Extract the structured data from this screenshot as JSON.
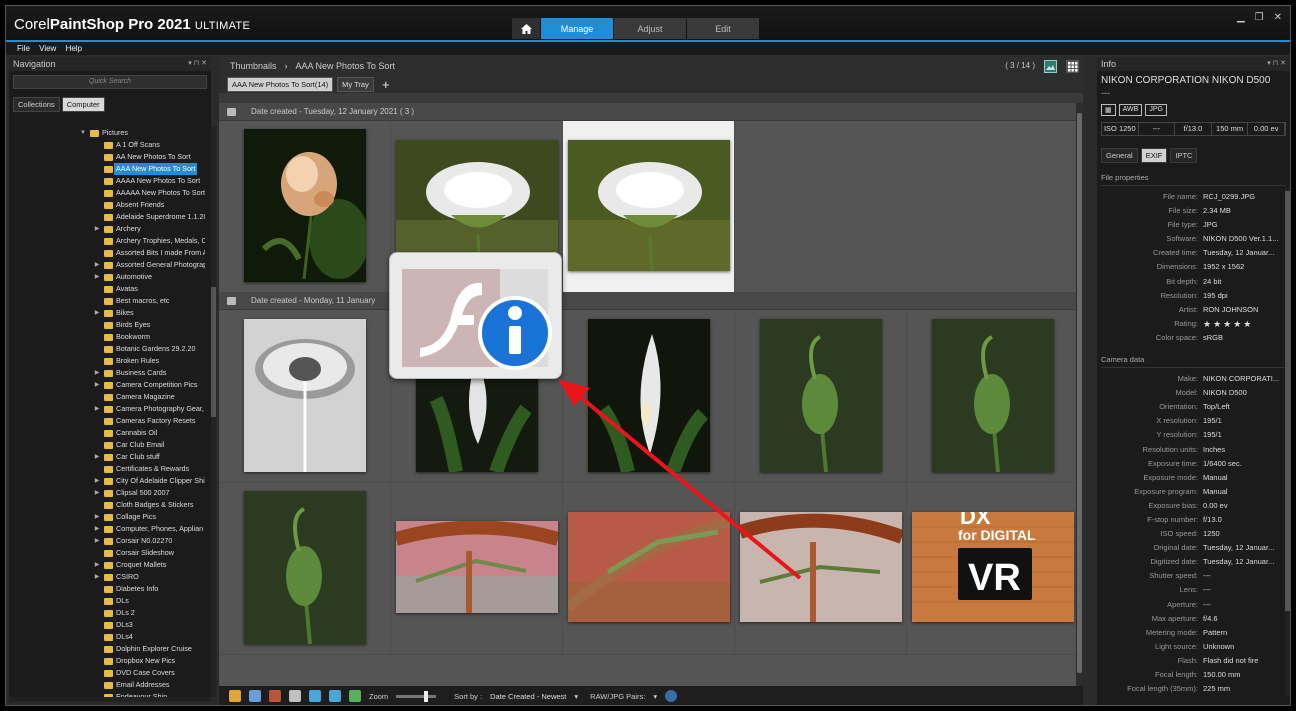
{
  "app": {
    "title_part1": "Corel",
    "title_part2": "PaintShop",
    "title_part3": "Pro 2021",
    "title_part4": "ULTIMATE"
  },
  "tabs": [
    {
      "label": "Manage"
    },
    {
      "label": "Adjust"
    },
    {
      "label": "Edit"
    }
  ],
  "menu": [
    "File",
    "View",
    "Help"
  ],
  "navigation": {
    "title": "Navigation",
    "search_placeholder": "Quick Search",
    "tabs": [
      "Collections",
      "Computer"
    ],
    "root": "Pictures",
    "items": [
      {
        "label": "A 1 Off Scans",
        "arrow": false
      },
      {
        "label": "AA New Photos To Sort",
        "arrow": false
      },
      {
        "label": "AAA New Photos To Sort",
        "arrow": false,
        "selected": true
      },
      {
        "label": "AAAA New Photos To Sort",
        "arrow": false
      },
      {
        "label": "AAAAA New Photos To Sort",
        "arrow": false
      },
      {
        "label": "Absent Friends",
        "arrow": false
      },
      {
        "label": "Adelaide Superdrome 1.1.20",
        "arrow": false
      },
      {
        "label": "Archery",
        "arrow": true
      },
      {
        "label": "Archery Trophies, Medals, C",
        "arrow": false
      },
      {
        "label": "Assorted Bits I made From A",
        "arrow": false
      },
      {
        "label": "Assorted General Photograp",
        "arrow": true
      },
      {
        "label": "Automotive",
        "arrow": true
      },
      {
        "label": "Avatas",
        "arrow": false
      },
      {
        "label": "Best macros, etc",
        "arrow": false
      },
      {
        "label": "Bikes",
        "arrow": true
      },
      {
        "label": "Birds Eyes",
        "arrow": false
      },
      {
        "label": "Bookworm",
        "arrow": false
      },
      {
        "label": "Botanic Gardens 29.2.20",
        "arrow": false
      },
      {
        "label": "Broken Rules",
        "arrow": false
      },
      {
        "label": "Business Cards",
        "arrow": true
      },
      {
        "label": "Camera Competition Pics",
        "arrow": true
      },
      {
        "label": "Camera Magazine",
        "arrow": false
      },
      {
        "label": "Camera Photography Gear,",
        "arrow": true
      },
      {
        "label": "Cameras Factory Resets",
        "arrow": false
      },
      {
        "label": "Cannabis Oil",
        "arrow": false
      },
      {
        "label": "Car Club Email",
        "arrow": false
      },
      {
        "label": "Car Club stuff",
        "arrow": true
      },
      {
        "label": "Certificates & Rewards",
        "arrow": false
      },
      {
        "label": "City Of Adelaide Clipper Shi",
        "arrow": true
      },
      {
        "label": "Clipsal 500 2007",
        "arrow": true
      },
      {
        "label": "Cloth Badges & Stickers",
        "arrow": false
      },
      {
        "label": "Collage Pics",
        "arrow": true
      },
      {
        "label": "Computer, Phones, Applian",
        "arrow": true
      },
      {
        "label": "Corsair N0.02270",
        "arrow": true
      },
      {
        "label": "Corsair Slideshow",
        "arrow": false
      },
      {
        "label": "Croquet Mallets",
        "arrow": true
      },
      {
        "label": "CSIRO",
        "arrow": true
      },
      {
        "label": "Diabetes Info",
        "arrow": false
      },
      {
        "label": "DLs",
        "arrow": false
      },
      {
        "label": "DLs 2",
        "arrow": false
      },
      {
        "label": "DLs3",
        "arrow": false
      },
      {
        "label": "DLs4",
        "arrow": false
      },
      {
        "label": "Dolphin Explorer Cruise",
        "arrow": false
      },
      {
        "label": "Dropbox New Pics",
        "arrow": false
      },
      {
        "label": "DVD Case Covers",
        "arrow": false
      },
      {
        "label": "Email Addresses",
        "arrow": false
      },
      {
        "label": "Endeavour Ship",
        "arrow": false
      }
    ]
  },
  "browser": {
    "breadcrumb_root": "Thumbnails",
    "breadcrumb_current": "AAA New Photos To Sort",
    "count": "( 3 / 14 )",
    "trays": [
      "AAA New Photos To Sort(14)",
      "My Tray"
    ],
    "group1": "Date created  -  Tuesday, 12 January 2021  ( 3 )",
    "group2": "Date created  -  Monday, 11 January",
    "toolbar": {
      "zoom_label": "Zoom",
      "sort_label": "Sort by :",
      "sort_value": "Date Created - Newest",
      "raw_label": "RAW/JPG Pairs:"
    }
  },
  "info": {
    "title": "Info",
    "camera": "NIKON CORPORATION NIKON D500",
    "dashes": "---",
    "badges": [
      "AWB",
      "JPG"
    ],
    "exif_strip": [
      "ISO 1250",
      "---",
      "f/13.0",
      "150 mm",
      "0.00 ev"
    ],
    "tabs": [
      "General",
      "EXIF",
      "IPTC"
    ],
    "file_section": "File properties",
    "file_props": [
      {
        "k": "File name:",
        "v": "RCJ_0299.JPG"
      },
      {
        "k": "File size:",
        "v": "2.34 MB"
      },
      {
        "k": "File type:",
        "v": "JPG"
      },
      {
        "k": "Software:",
        "v": "NIKON D500 Ver.1.1..."
      },
      {
        "k": "Created time:",
        "v": "Tuesday, 12 Januar..."
      },
      {
        "k": "Dimensions:",
        "v": "1952 x 1562"
      },
      {
        "k": "Bit depth:",
        "v": "24 bit"
      },
      {
        "k": "Resolution:",
        "v": "195 dpi"
      },
      {
        "k": "Artist:",
        "v": "RON JOHNSON"
      },
      {
        "k": "Rating:",
        "v": "★★★★★"
      },
      {
        "k": "Color space:",
        "v": "sRGB"
      }
    ],
    "camera_section": "Camera data",
    "camera_props": [
      {
        "k": "Make:",
        "v": "NIKON CORPORATI..."
      },
      {
        "k": "Model:",
        "v": "NIKON D500"
      },
      {
        "k": "Orientation:",
        "v": "Top/Left"
      },
      {
        "k": "X resolution:",
        "v": "195/1"
      },
      {
        "k": "Y resolution:",
        "v": "195/1"
      },
      {
        "k": "Resolution units:",
        "v": "Inches"
      },
      {
        "k": "Exposure time:",
        "v": "1/6400 sec."
      },
      {
        "k": "Exposure mode:",
        "v": "Manual"
      },
      {
        "k": "Exposure program:",
        "v": "Manual"
      },
      {
        "k": "Exposure bias:",
        "v": "0.00 ev"
      },
      {
        "k": "F-stop number:",
        "v": "f/13.0"
      },
      {
        "k": "ISO speed:",
        "v": "1250"
      },
      {
        "k": "Original date:",
        "v": "Tuesday, 12 Januar..."
      },
      {
        "k": "Digitized date:",
        "v": "Tuesday, 12 Januar..."
      },
      {
        "k": "Shutter speed:",
        "v": "---"
      },
      {
        "k": "Lens:",
        "v": "---"
      },
      {
        "k": "Aperture:",
        "v": "---"
      },
      {
        "k": "Max aperture:",
        "v": "f/4.6"
      },
      {
        "k": "Metering mode:",
        "v": "Pattern"
      },
      {
        "k": "Light source:",
        "v": "Unknown"
      },
      {
        "k": "Flash:",
        "v": "Flash did not fire"
      },
      {
        "k": "Focal length:",
        "v": "150.00 mm"
      },
      {
        "k": "Focal length (35mm):",
        "v": "225 mm"
      }
    ]
  },
  "thumbnail_text": {
    "dx": "DX",
    "for_digital": "for DIGITAL",
    "vr": "VR"
  },
  "colors": {
    "accent": "#1f8ed6",
    "arrow": "#e8151b",
    "folder": "#e6b94a"
  }
}
